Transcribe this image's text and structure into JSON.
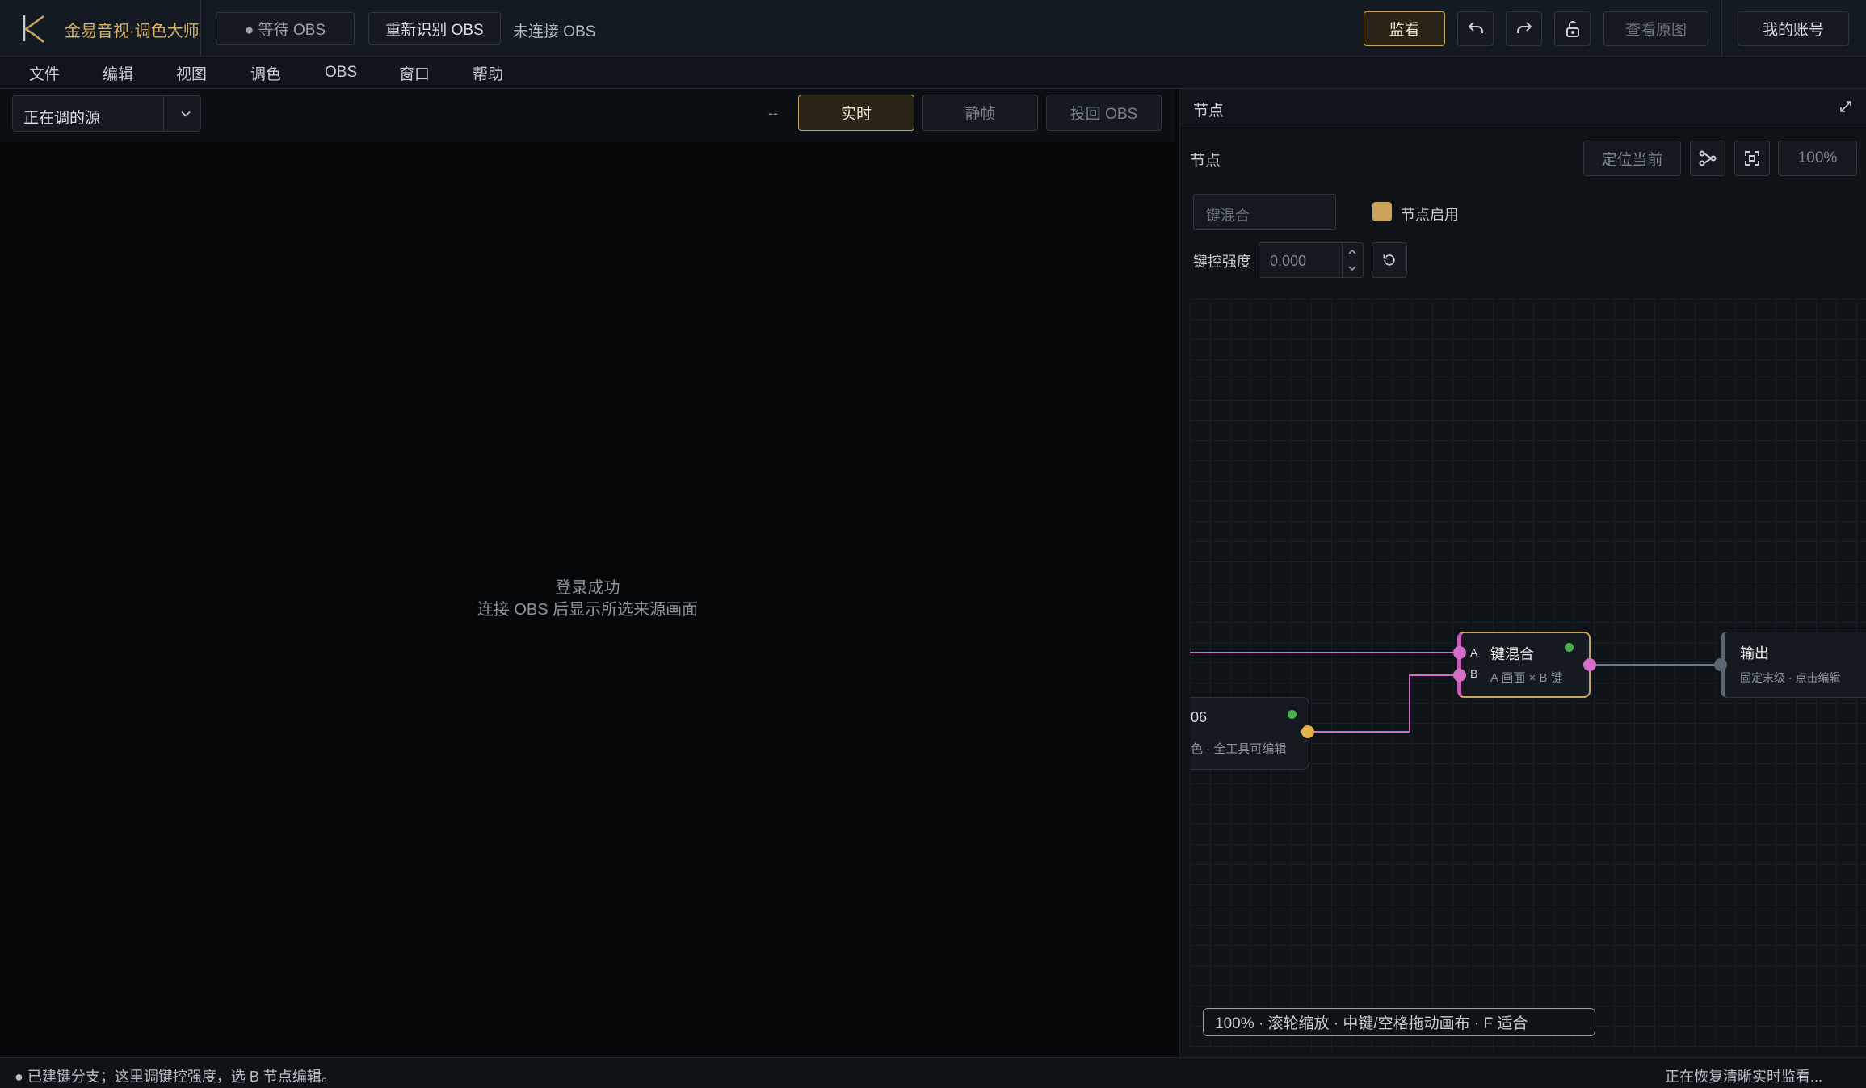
{
  "app": {
    "title": "金易音视·调色大师",
    "logo_letter": "K"
  },
  "topbar": {
    "obs_status": "● 等待 OBS",
    "redetect_label": "重新识别 OBS",
    "connection_text": "未连接 OBS",
    "monitor_label": "监看",
    "view_original_label": "查看原图",
    "account_label": "我的账号"
  },
  "menu": [
    "文件",
    "编辑",
    "视图",
    "调色",
    "OBS",
    "窗口",
    "帮助"
  ],
  "toolbar": {
    "source_select": "正在调的源",
    "frame_counter": "--",
    "live_label": "实时",
    "still_label": "静帧",
    "return_label": "投回 OBS"
  },
  "preview": {
    "line1": "登录成功",
    "line2": "连接 OBS 后显示所选来源画面"
  },
  "panel": {
    "title": "节点",
    "section_label": "节点",
    "locate_label": "定位当前",
    "zoom": "100%",
    "node_name_placeholder": "键混合",
    "enable_label": "节点启用",
    "strength_label": "键控强度",
    "strength_value": "0.000"
  },
  "graph": {
    "key_node": {
      "title": "键混合",
      "subtitle": "A 画面 × B 键",
      "port_a": "A",
      "port_b": "B"
    },
    "output_node": {
      "title": "输出",
      "subtitle": "固定末级 · 点击编辑"
    },
    "left_node": {
      "title": "06",
      "subtitle": "色 · 全工具可编辑"
    },
    "hint": "100% · 滚轮缩放 · 中键/空格拖动画布 · F 适合"
  },
  "status": {
    "left": "● 已建键分支；这里调键控强度，选 B 节点编辑。",
    "right": "正在恢复清晰实时监看..."
  },
  "colors": {
    "gold": "#c9a45a",
    "pink": "#d46ec8",
    "green": "#4caf50"
  }
}
